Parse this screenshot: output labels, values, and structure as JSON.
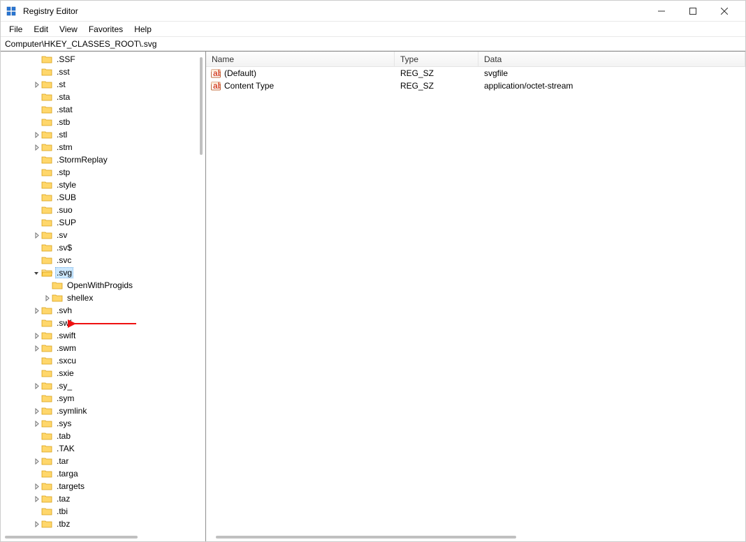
{
  "window": {
    "title": "Registry Editor"
  },
  "menu": {
    "items": [
      "File",
      "Edit",
      "View",
      "Favorites",
      "Help"
    ]
  },
  "address": "Computer\\HKEY_CLASSES_ROOT\\.svg",
  "tree": {
    "items": [
      {
        "label": ".SSF",
        "indent": 3,
        "expandable": false,
        "expanded": false,
        "selected": false
      },
      {
        "label": ".sst",
        "indent": 3,
        "expandable": false,
        "expanded": false,
        "selected": false
      },
      {
        "label": ".st",
        "indent": 3,
        "expandable": true,
        "expanded": false,
        "selected": false
      },
      {
        "label": ".sta",
        "indent": 3,
        "expandable": false,
        "expanded": false,
        "selected": false
      },
      {
        "label": ".stat",
        "indent": 3,
        "expandable": false,
        "expanded": false,
        "selected": false
      },
      {
        "label": ".stb",
        "indent": 3,
        "expandable": false,
        "expanded": false,
        "selected": false
      },
      {
        "label": ".stl",
        "indent": 3,
        "expandable": true,
        "expanded": false,
        "selected": false
      },
      {
        "label": ".stm",
        "indent": 3,
        "expandable": true,
        "expanded": false,
        "selected": false
      },
      {
        "label": ".StormReplay",
        "indent": 3,
        "expandable": false,
        "expanded": false,
        "selected": false
      },
      {
        "label": ".stp",
        "indent": 3,
        "expandable": false,
        "expanded": false,
        "selected": false
      },
      {
        "label": ".style",
        "indent": 3,
        "expandable": false,
        "expanded": false,
        "selected": false
      },
      {
        "label": ".SUB",
        "indent": 3,
        "expandable": false,
        "expanded": false,
        "selected": false
      },
      {
        "label": ".suo",
        "indent": 3,
        "expandable": false,
        "expanded": false,
        "selected": false
      },
      {
        "label": ".SUP",
        "indent": 3,
        "expandable": false,
        "expanded": false,
        "selected": false
      },
      {
        "label": ".sv",
        "indent": 3,
        "expandable": true,
        "expanded": false,
        "selected": false
      },
      {
        "label": ".sv$",
        "indent": 3,
        "expandable": false,
        "expanded": false,
        "selected": false
      },
      {
        "label": ".svc",
        "indent": 3,
        "expandable": false,
        "expanded": false,
        "selected": false
      },
      {
        "label": ".svg",
        "indent": 3,
        "expandable": true,
        "expanded": true,
        "selected": true
      },
      {
        "label": "OpenWithProgids",
        "indent": 4,
        "expandable": false,
        "expanded": false,
        "selected": false
      },
      {
        "label": "shellex",
        "indent": 4,
        "expandable": true,
        "expanded": false,
        "selected": false
      },
      {
        "label": ".svh",
        "indent": 3,
        "expandable": true,
        "expanded": false,
        "selected": false
      },
      {
        "label": ".swf",
        "indent": 3,
        "expandable": false,
        "expanded": false,
        "selected": false
      },
      {
        "label": ".swift",
        "indent": 3,
        "expandable": true,
        "expanded": false,
        "selected": false
      },
      {
        "label": ".swm",
        "indent": 3,
        "expandable": true,
        "expanded": false,
        "selected": false
      },
      {
        "label": ".sxcu",
        "indent": 3,
        "expandable": false,
        "expanded": false,
        "selected": false
      },
      {
        "label": ".sxie",
        "indent": 3,
        "expandable": false,
        "expanded": false,
        "selected": false
      },
      {
        "label": ".sy_",
        "indent": 3,
        "expandable": true,
        "expanded": false,
        "selected": false
      },
      {
        "label": ".sym",
        "indent": 3,
        "expandable": false,
        "expanded": false,
        "selected": false
      },
      {
        "label": ".symlink",
        "indent": 3,
        "expandable": true,
        "expanded": false,
        "selected": false
      },
      {
        "label": ".sys",
        "indent": 3,
        "expandable": true,
        "expanded": false,
        "selected": false
      },
      {
        "label": ".tab",
        "indent": 3,
        "expandable": false,
        "expanded": false,
        "selected": false
      },
      {
        "label": ".TAK",
        "indent": 3,
        "expandable": false,
        "expanded": false,
        "selected": false
      },
      {
        "label": ".tar",
        "indent": 3,
        "expandable": true,
        "expanded": false,
        "selected": false
      },
      {
        "label": ".targa",
        "indent": 3,
        "expandable": false,
        "expanded": false,
        "selected": false
      },
      {
        "label": ".targets",
        "indent": 3,
        "expandable": true,
        "expanded": false,
        "selected": false
      },
      {
        "label": ".taz",
        "indent": 3,
        "expandable": true,
        "expanded": false,
        "selected": false
      },
      {
        "label": ".tbi",
        "indent": 3,
        "expandable": false,
        "expanded": false,
        "selected": false
      },
      {
        "label": ".tbz",
        "indent": 3,
        "expandable": true,
        "expanded": false,
        "selected": false
      }
    ]
  },
  "values": {
    "headers": {
      "name": "Name",
      "type": "Type",
      "data": "Data"
    },
    "rows": [
      {
        "name": "(Default)",
        "type": "REG_SZ",
        "data": "svgfile"
      },
      {
        "name": "Content Type",
        "type": "REG_SZ",
        "data": "application/octet-stream"
      }
    ]
  }
}
